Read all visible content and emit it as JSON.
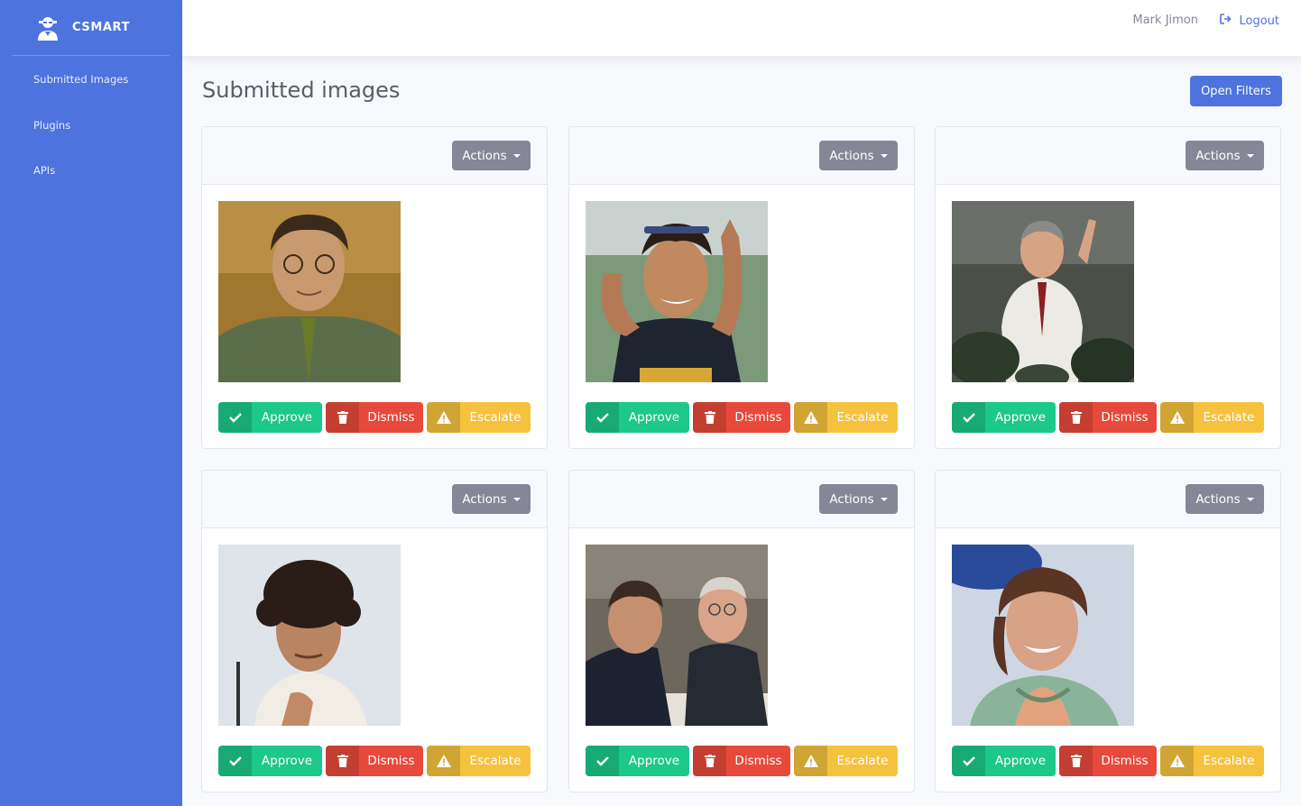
{
  "app": {
    "brand": "CSMART"
  },
  "sidebar": {
    "items": [
      {
        "label": "Submitted Images"
      },
      {
        "label": "Plugins"
      },
      {
        "label": "APIs"
      }
    ]
  },
  "topbar": {
    "user_name": "Mark Jimon",
    "logout_label": "Logout"
  },
  "page": {
    "title": "Submitted images",
    "filters_label": "Open Filters"
  },
  "cards": [
    {
      "actions_label": "Actions",
      "approve_label": "Approve",
      "dismiss_label": "Dismiss",
      "escalate_label": "Escalate"
    },
    {
      "actions_label": "Actions",
      "approve_label": "Approve",
      "dismiss_label": "Dismiss",
      "escalate_label": "Escalate"
    },
    {
      "actions_label": "Actions",
      "approve_label": "Approve",
      "dismiss_label": "Dismiss",
      "escalate_label": "Escalate"
    },
    {
      "actions_label": "Actions",
      "approve_label": "Approve",
      "dismiss_label": "Dismiss",
      "escalate_label": "Escalate"
    },
    {
      "actions_label": "Actions",
      "approve_label": "Approve",
      "dismiss_label": "Dismiss",
      "escalate_label": "Escalate"
    },
    {
      "actions_label": "Actions",
      "approve_label": "Approve",
      "dismiss_label": "Dismiss",
      "escalate_label": "Escalate"
    }
  ],
  "colors": {
    "primary": "#4e73df",
    "success": "#1cc88a",
    "danger": "#e74a3b",
    "warning": "#f6c23e",
    "secondary": "#858796"
  }
}
